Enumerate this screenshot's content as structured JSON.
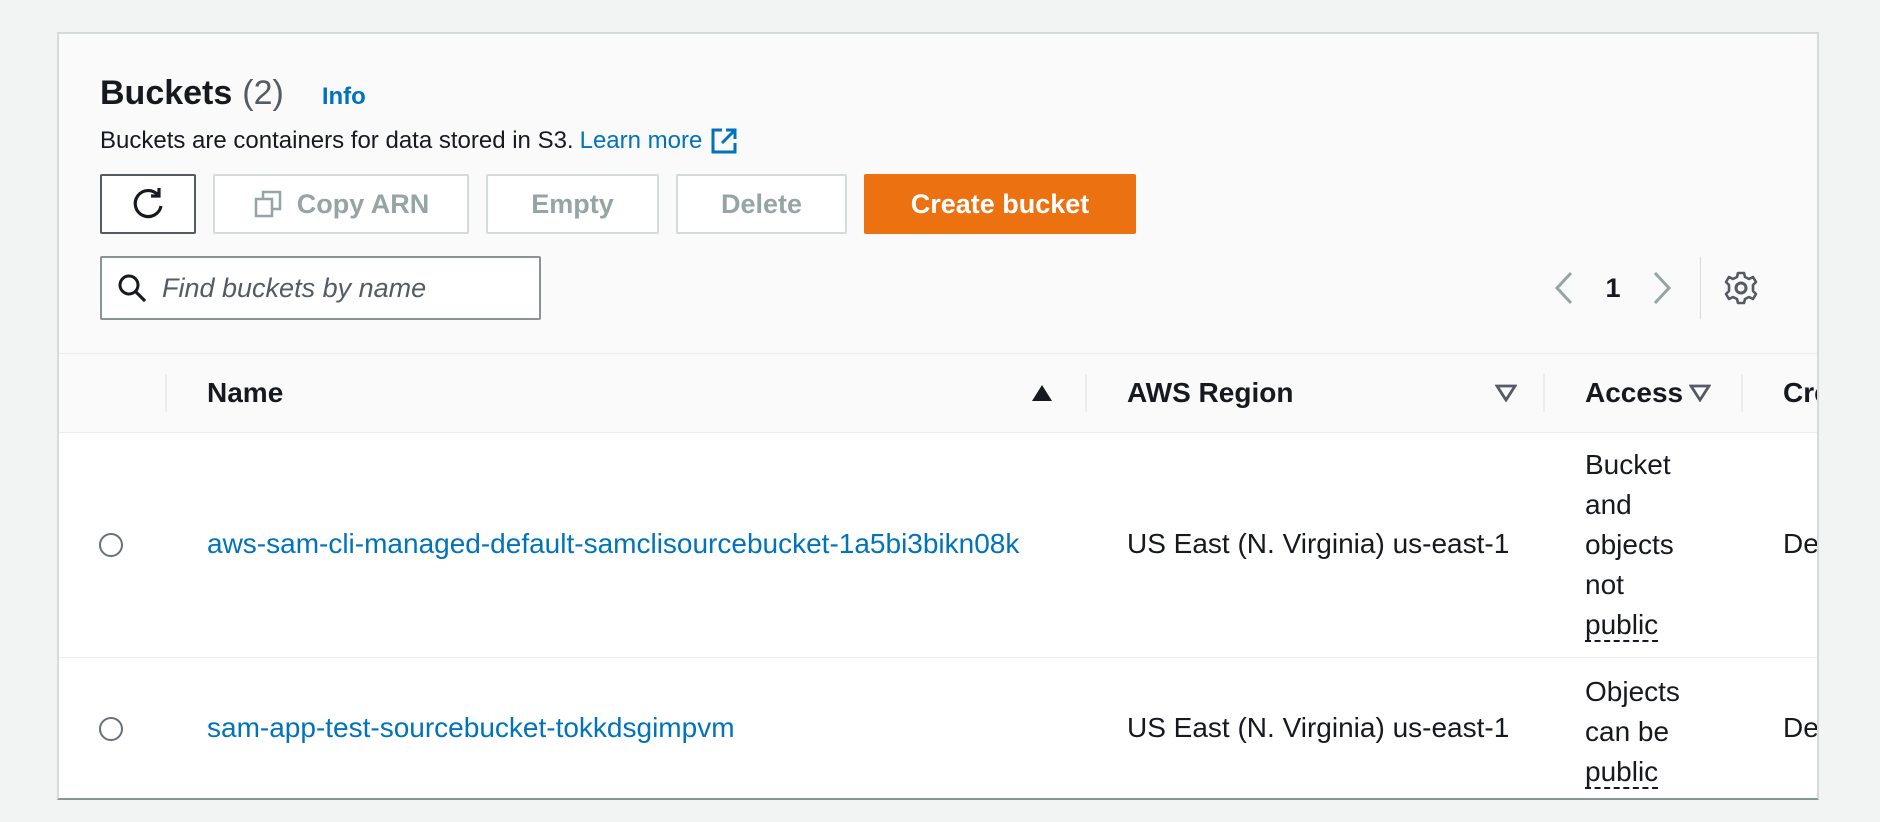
{
  "header": {
    "title": "Buckets",
    "count": "(2)",
    "info_label": "Info",
    "description": "Buckets are containers for data stored in S3.",
    "learn_more": "Learn more"
  },
  "toolbar": {
    "refresh_icon": "refresh-icon",
    "copy_arn": "Copy ARN",
    "empty": "Empty",
    "delete": "Delete",
    "create_bucket": "Create bucket"
  },
  "search": {
    "placeholder": "Find buckets by name",
    "value": ""
  },
  "pagination": {
    "current_page": "1"
  },
  "table": {
    "columns": [
      "Name",
      "AWS Region",
      "Access",
      "Cre"
    ],
    "rows": [
      {
        "name": "aws-sam-cli-managed-default-samclisourcebucket-1a5bi3bikn08k",
        "region": "US East (N. Virginia) us-east-1",
        "access": [
          "Bucket",
          "and",
          "objects",
          "not",
          "public"
        ],
        "created": "Dec"
      },
      {
        "name": "sam-app-test-sourcebucket-tokkdsgimpvm",
        "region": "US East (N. Virginia) us-east-1",
        "access": [
          "Objects",
          "can be",
          "public"
        ],
        "created": "Dec"
      }
    ]
  },
  "colors": {
    "accent": "#ec7211",
    "link": "#0073bb",
    "text": "#16191f",
    "disabled": "#95a5a6"
  }
}
